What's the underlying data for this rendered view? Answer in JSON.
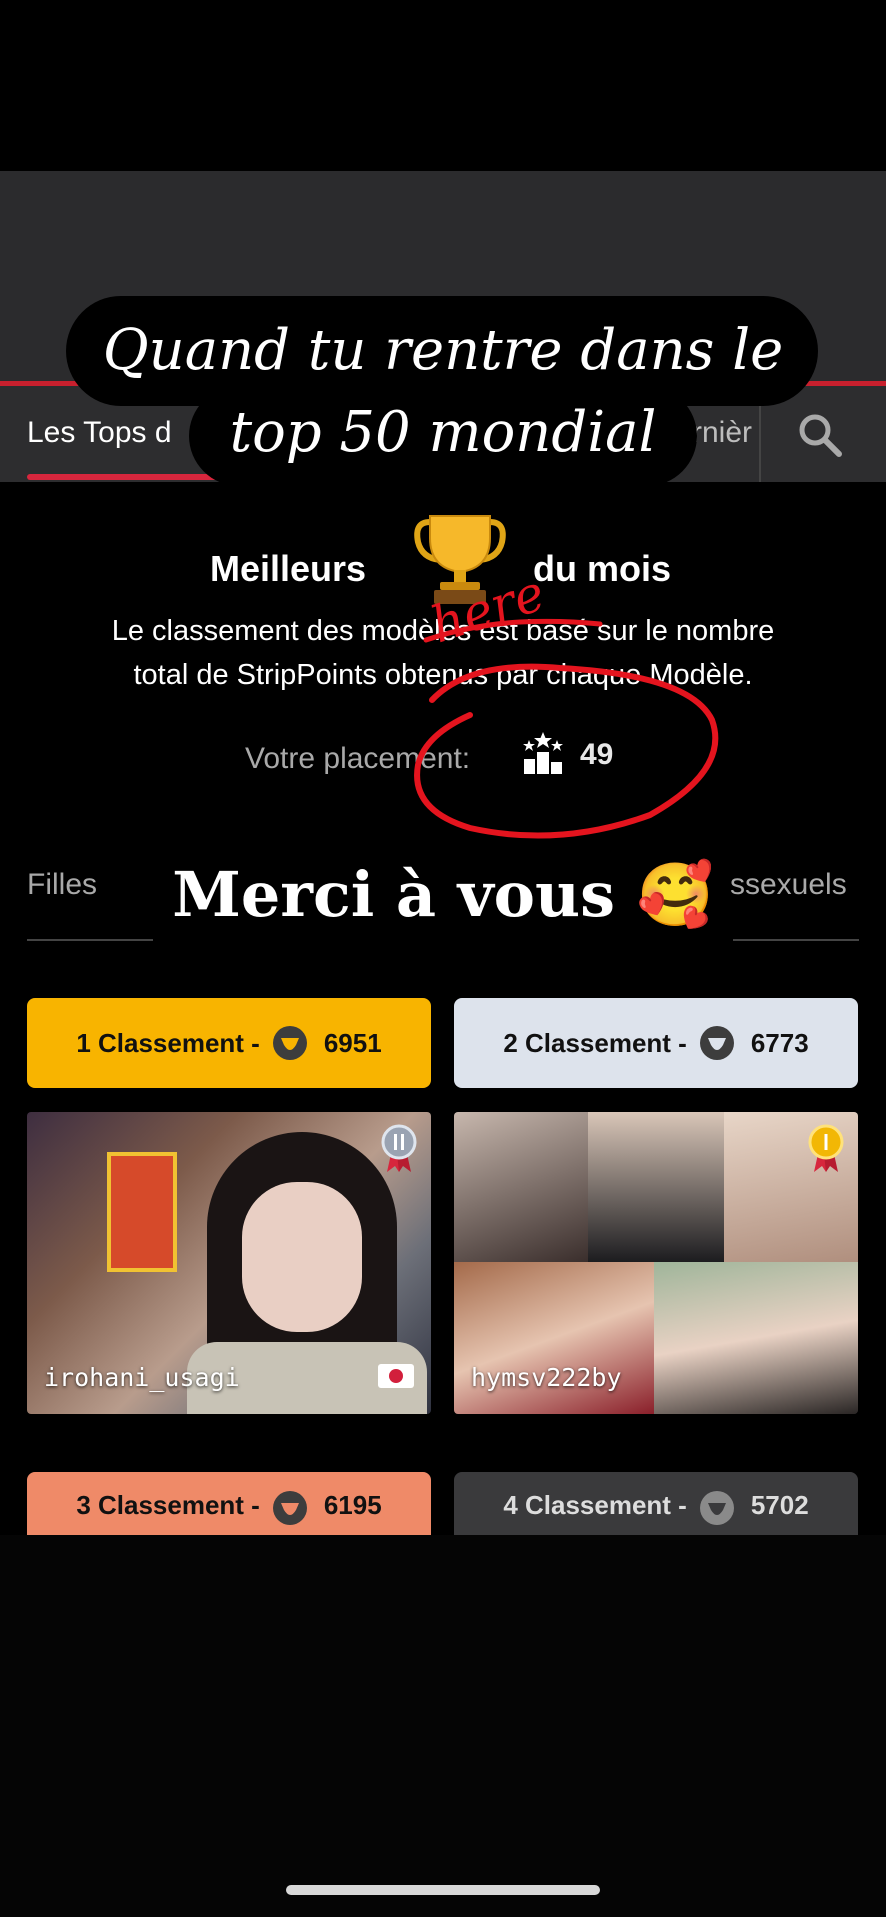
{
  "nav": {
    "tab_active": "Les Tops d",
    "tab_right": "rnièr",
    "search_icon": "search-icon"
  },
  "caption": {
    "line1": "Quand tu rentre dans le",
    "line2": "top 50 mondial"
  },
  "header": {
    "title_left": "Meilleurs",
    "title_right": "du mois",
    "trophy_icon": "trophy-emoji-icon",
    "description_line1": "Le classement des modèles est basé sur le nombre",
    "description_line2": "total de StripPoints obtenus par chaque Modèle.",
    "placement_label": "Votre placement:",
    "placement_value": "49"
  },
  "annotation": {
    "handwritten": "here",
    "color": "#e4141e"
  },
  "filters": {
    "left": "Filles",
    "right": "ssexuels"
  },
  "overlay": {
    "merci": "Merci à vous 🥰"
  },
  "ranking": [
    {
      "label": "1 Classement -",
      "points": "6951",
      "color": "#f8b400"
    },
    {
      "label": "2 Classement -",
      "points": "6773",
      "color": "#dde3ec"
    },
    {
      "label": "3 Classement -",
      "points": "6195",
      "color": "#ef8a68"
    },
    {
      "label": "4 Classement -",
      "points": "5702",
      "color": "#3a3a3c"
    }
  ],
  "models": [
    {
      "username": "irohani_usagi",
      "badge": "silver-medal-icon",
      "flag": "japan-flag-icon"
    },
    {
      "username": "hymsv222by",
      "badge": "gold-medal-icon"
    }
  ]
}
